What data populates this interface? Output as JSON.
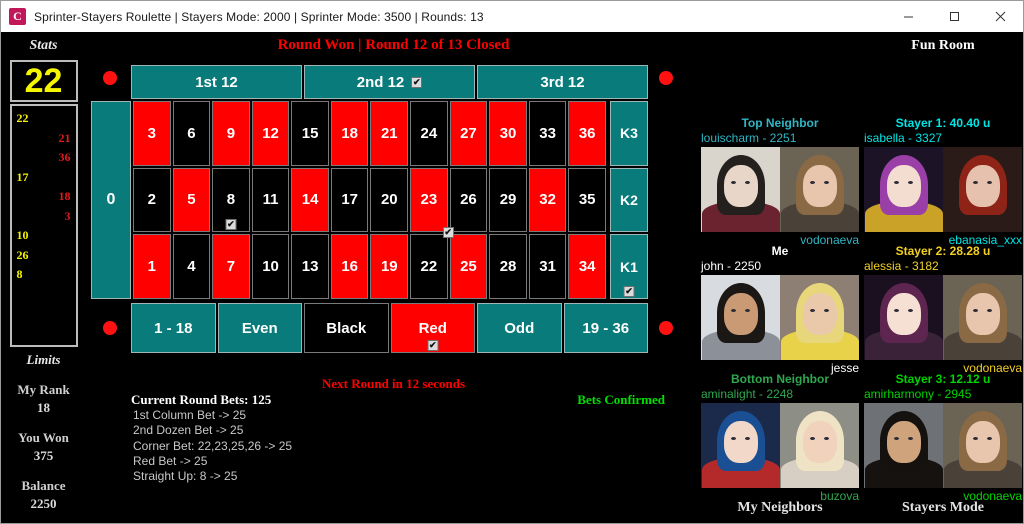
{
  "window": {
    "title": "Sprinter-Stayers Roulette | Stayers Mode: 2000 | Sprinter Mode: 3500 | Rounds: 13",
    "app_icon_letter": "C",
    "minimize_label": "minimize-icon",
    "maximize_label": "maximize-icon",
    "close_label": "close-icon"
  },
  "stats": {
    "title": "Stats",
    "last_number": "22",
    "history": [
      {
        "value": "22",
        "align": "left",
        "color": "#f5f500"
      },
      {
        "value": "21",
        "align": "right",
        "color": "#e21b1b"
      },
      {
        "value": "36",
        "align": "right",
        "color": "#e21b1b"
      },
      {
        "value": "17",
        "align": "left",
        "color": "#f5f500"
      },
      {
        "value": "18",
        "align": "right",
        "color": "#e21b1b"
      },
      {
        "value": "3",
        "align": "right",
        "color": "#e21b1b"
      },
      {
        "value": "10",
        "align": "left",
        "color": "#f5f500"
      },
      {
        "value": "26",
        "align": "left",
        "color": "#f5f500"
      },
      {
        "value": "8",
        "align": "left",
        "color": "#f5f500"
      }
    ],
    "limits_title": "Limits",
    "my_rank_label": "My Rank",
    "my_rank_value": "18",
    "you_won_label": "You Won",
    "you_won_value": "375",
    "balance_label": "Balance",
    "balance_value": "2250"
  },
  "center": {
    "round_status": "Round Won | Round 12 of 13 Closed",
    "next_round": "Next Round in 12 seconds",
    "bets_total": "Current Round Bets: 125",
    "bets_confirmed": "Bets Confirmed",
    "bet_lines": [
      "1st Column Bet -> 25",
      "2nd Dozen Bet -> 25",
      "Corner Bet: 22,23,25,26 -> 25",
      "Red Bet -> 25",
      "Straight Up: 8 -> 25"
    ]
  },
  "table": {
    "zero_label": "0",
    "dozens": [
      {
        "label": "1st 12",
        "checked": false
      },
      {
        "label": "2nd 12",
        "checked": true
      },
      {
        "label": "3rd 12",
        "checked": false
      }
    ],
    "numbers": [
      {
        "n": "3",
        "color": "red"
      },
      {
        "n": "6",
        "color": "black"
      },
      {
        "n": "9",
        "color": "red"
      },
      {
        "n": "12",
        "color": "red"
      },
      {
        "n": "15",
        "color": "black"
      },
      {
        "n": "18",
        "color": "red"
      },
      {
        "n": "21",
        "color": "red"
      },
      {
        "n": "24",
        "color": "black"
      },
      {
        "n": "27",
        "color": "red"
      },
      {
        "n": "30",
        "color": "red"
      },
      {
        "n": "33",
        "color": "black"
      },
      {
        "n": "36",
        "color": "red"
      },
      {
        "n": "2",
        "color": "black"
      },
      {
        "n": "5",
        "color": "red"
      },
      {
        "n": "8",
        "color": "black",
        "checked": true
      },
      {
        "n": "11",
        "color": "black"
      },
      {
        "n": "14",
        "color": "red"
      },
      {
        "n": "17",
        "color": "black"
      },
      {
        "n": "20",
        "color": "black"
      },
      {
        "n": "23",
        "color": "red",
        "corner": true
      },
      {
        "n": "26",
        "color": "black"
      },
      {
        "n": "29",
        "color": "black"
      },
      {
        "n": "32",
        "color": "red"
      },
      {
        "n": "35",
        "color": "black"
      },
      {
        "n": "1",
        "color": "red"
      },
      {
        "n": "4",
        "color": "black"
      },
      {
        "n": "7",
        "color": "red"
      },
      {
        "n": "10",
        "color": "black"
      },
      {
        "n": "13",
        "color": "black"
      },
      {
        "n": "16",
        "color": "red"
      },
      {
        "n": "19",
        "color": "red"
      },
      {
        "n": "22",
        "color": "black"
      },
      {
        "n": "25",
        "color": "red"
      },
      {
        "n": "28",
        "color": "black"
      },
      {
        "n": "31",
        "color": "black"
      },
      {
        "n": "34",
        "color": "red"
      }
    ],
    "columns": [
      {
        "label": "K3",
        "checked": false
      },
      {
        "label": "K2",
        "checked": false
      },
      {
        "label": "K1",
        "checked": true
      }
    ],
    "outside": [
      {
        "label": "1 - 18",
        "style": "teal",
        "checked": false
      },
      {
        "label": "Even",
        "style": "teal",
        "checked": false
      },
      {
        "label": "Black",
        "style": "black",
        "checked": false
      },
      {
        "label": "Red",
        "style": "red",
        "checked": true
      },
      {
        "label": "Odd",
        "style": "teal",
        "checked": false
      },
      {
        "label": "19 - 36",
        "style": "teal",
        "checked": false
      }
    ],
    "colors": {
      "teal": "#0a7b7b",
      "red": "#ff0000",
      "black": "#000000",
      "marker_dot": "#ff1111"
    }
  },
  "right_panel": {
    "fun_room_title": "Fun Room",
    "my_neighbors_label": "My Neighbors",
    "stayers_mode_label": "Stayers Mode",
    "cards": [
      {
        "id": "top-neighbor",
        "head": "Top Neighbor",
        "head_color": "#2fb6c4",
        "name": "louischarm -  2251",
        "name_color": "#2fb6c4",
        "foot": "vodonaeva",
        "foot_color": "#2fb6c4"
      },
      {
        "id": "stayer-1",
        "head": "Stayer 1: 40.40 u",
        "head_color": "#00e5e5",
        "name": "isabella -  3327",
        "name_color": "#00e5e5",
        "foot": "ebanasia_xxx",
        "foot_color": "#00e5e5"
      },
      {
        "id": "me",
        "head": "Me",
        "head_color": "#ffffff",
        "name": "john - 2250",
        "name_color": "#ffffff",
        "foot": "jesse",
        "foot_color": "#ffffff"
      },
      {
        "id": "stayer-2",
        "head": "Stayer 2: 28.28 u",
        "head_color": "#f2d024",
        "name": "alessia -  3182",
        "name_color": "#f2d024",
        "foot": "vodonaeva",
        "foot_color": "#f2d024"
      },
      {
        "id": "bottom-neighbor",
        "head": "Bottom Neighbor",
        "head_color": "#2fa84f",
        "name": "aminalight -  2248",
        "name_color": "#2fa84f",
        "foot": "buzova",
        "foot_color": "#2fa84f"
      },
      {
        "id": "stayer-3",
        "head": "Stayer 3: 12.12 u",
        "head_color": "#00d400",
        "name": "amirharmony -  2945",
        "name_color": "#00d400",
        "foot": "vodonaeva",
        "foot_color": "#00d400"
      }
    ]
  }
}
